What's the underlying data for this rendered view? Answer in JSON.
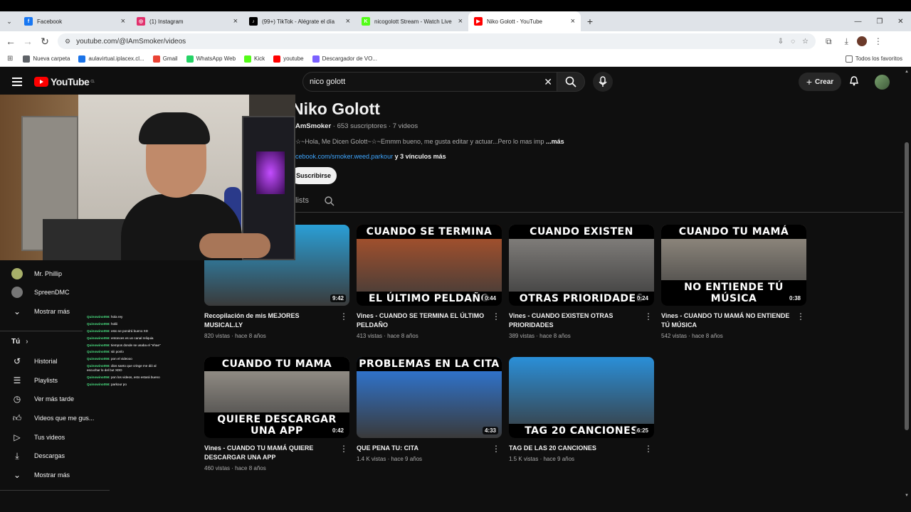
{
  "browser": {
    "tabs": [
      {
        "title": "Facebook",
        "color": "#1877f2",
        "glyph": "f"
      },
      {
        "title": "(1) Instagram",
        "color": "#e1306c",
        "glyph": "◎"
      },
      {
        "title": "(99+) TikTok - Alégrate el día",
        "color": "#000000",
        "glyph": "♪"
      },
      {
        "title": "nicogolott Stream - Watch Live",
        "color": "#53fc18",
        "glyph": "K"
      },
      {
        "title": "Niko Golott - YouTube",
        "color": "#ff0000",
        "glyph": "▶"
      }
    ],
    "url": "youtube.com/@IAmSmoker/videos",
    "bookmarks": [
      {
        "label": "Nueva carpeta",
        "color": "#5f6368"
      },
      {
        "label": "aulavirtual.iplacex.cl...",
        "color": "#1a73e8"
      },
      {
        "label": "Gmail",
        "color": "#ea4335"
      },
      {
        "label": "WhatsApp Web",
        "color": "#25d366"
      },
      {
        "label": "Kick",
        "color": "#53fc18"
      },
      {
        "label": "youtube",
        "color": "#ff0000"
      },
      {
        "label": "Descargador de VO...",
        "color": "#7b61ff"
      }
    ],
    "all_bookmarks": "Todos los favoritos"
  },
  "youtube": {
    "logo": "YouTube",
    "region": "CL",
    "search_value": "nico golott",
    "create_label": "Crear",
    "channel": {
      "name": "Niko Golott",
      "handle": "AmSmoker",
      "stats": " · 653 suscriptores · 7 videos",
      "description": "☆~Hola, Me Dicen Golott~☆~Emmm bueno, me gusta editar y actuar...Pero lo mas imp",
      "more": "...más",
      "link": "cebook.com/smoker.weed.parkour",
      "links_more": " y 3 vínculos más",
      "subscribe": "Suscribirse",
      "tab": "lists"
    },
    "videos": [
      {
        "title": "Recopilación de mis MEJORES MUSICAL.LY",
        "views": "820 vistas",
        "age": "hace 8 años",
        "duration": "9:42",
        "top": "",
        "bottom": "",
        "bg": "#2a9fd6"
      },
      {
        "title": "Vines - CUANDO SE TERMINA EL ÚLTIMO PELDAÑO",
        "views": "413 vistas",
        "age": "hace 8 años",
        "duration": "0:44",
        "top": "CUANDO SE TERMINA",
        "bottom": "EL ÚLTIMO PELDAÑO",
        "bg": "#b5542a"
      },
      {
        "title": "Vines - CUANDO EXISTEN OTRAS PRIORIDADES",
        "views": "389 vistas",
        "age": "hace 8 años",
        "duration": "0:24",
        "top": "CUANDO EXISTEN",
        "bottom": "OTRAS PRIORIDADES",
        "bg": "#8d8a86"
      },
      {
        "title": "Vines - CUANDO TU MAMÁ NO ENTIENDE TÚ MÚSICA",
        "views": "542 vistas",
        "age": "hace 8 años",
        "duration": "0:38",
        "top": "CUANDO TU MAMÁ",
        "bottom": "NO ENTIENDE TÚ MÚSICA",
        "bg": "#9c9488"
      },
      {
        "title": "Vines - CUANDO TU MAMÁ QUIERE DESCARGAR UNA APP",
        "views": "460 vistas",
        "age": "hace 8 años",
        "duration": "0:42",
        "top": "CUANDO TU MAMA",
        "bottom": "QUIERE DESCARGAR UNA APP",
        "bg": "#a29c93"
      },
      {
        "title": "QUE PENA TU: CITA",
        "views": "1.4 K vistas",
        "age": "hace 9 años",
        "duration": "4:33",
        "top": "PROBLEMAS EN LA CITA",
        "bottom": "",
        "bg": "#2d7ee8"
      },
      {
        "title": "TAG DE LAS 20 CANCIONES",
        "views": "1.5 K vistas",
        "age": "hace 9 años",
        "duration": "6:25",
        "top": "",
        "bottom": "TAG 20 CANCIONES",
        "bg": "#2a8fd8"
      }
    ],
    "sidebar": {
      "subs": [
        {
          "name": "Mr. Phillip",
          "color": "#a8b06a"
        },
        {
          "name": "SpreenDMC",
          "color": "#777777"
        }
      ],
      "show_more_1": "Mostrar más",
      "you_header": "Tú",
      "items": [
        "Historial",
        "Playlists",
        "Ver más tarde",
        "Videos que me gus...",
        "Tus videos",
        "Descargas"
      ],
      "show_more_2": "Mostrar más"
    }
  },
  "stream_chat": [
    {
      "user": "Quinowino056",
      "msg": ": hola rey"
    },
    {
      "user": "Quinowino056",
      "msg": ": holiii"
    },
    {
      "user": "Quinowino056",
      "msg": ": esto se pondrá bueno XD"
    },
    {
      "user": "Quinowino056",
      "msg": ": entonces es un canal reliquia"
    },
    {
      "user": "Quinowino056",
      "msg": ": tiempos donde se usaba el \"ehae\""
    },
    {
      "user": "Quinowino056",
      "msg": ": siii ponlo"
    },
    {
      "user": "Quinowino056",
      "msg": ": pon el videooo"
    },
    {
      "user": "Quinowino056",
      "msg": ": dios santo que cringe me dió al escuchar lo del but XDD"
    },
    {
      "user": "Quinowino056",
      "msg": ": pon los videos, esto estará bueno"
    },
    {
      "user": "Quinowino056",
      "msg": ": parkour po"
    }
  ]
}
